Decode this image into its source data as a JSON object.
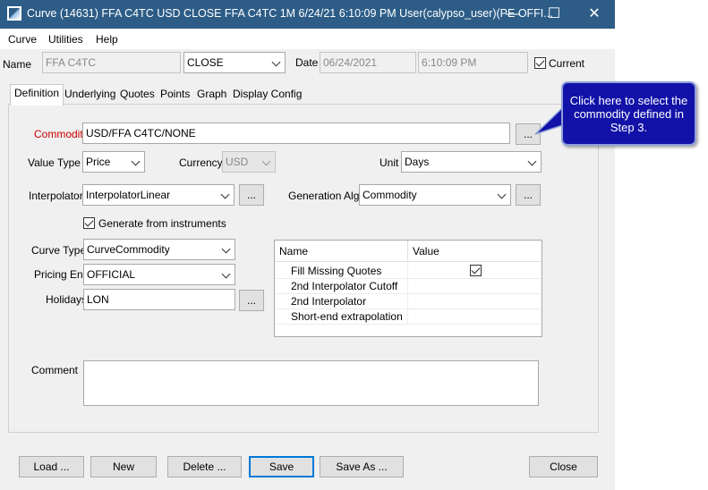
{
  "window": {
    "title": "Curve (14631) FFA C4TC USD CLOSE FFA C4TC 1M 6/24/21 6:10:09 PM User(calypso_user)(PE OFFI...",
    "minimize": "—",
    "maximize": "☐",
    "close": "✕"
  },
  "menu": {
    "items": [
      "Curve",
      "Utilities",
      "Help"
    ]
  },
  "header": {
    "name_label": "Name",
    "name_value": "FFA C4TC",
    "quote_set": "CLOSE",
    "date_label": "Date",
    "date_value": "06/24/2021",
    "time_value": "6:10:09 PM",
    "current_label": "Current",
    "current_checked": true
  },
  "tabs": [
    "Definition",
    "Underlying",
    "Quotes",
    "Points",
    "Graph",
    "Display Config"
  ],
  "definition": {
    "commodity_label": "Commodity",
    "commodity_value": "USD/FFA C4TC/NONE",
    "ellipsis": "...",
    "value_type_label": "Value Type",
    "value_type": "Price",
    "currency_label": "Currency",
    "currency": "USD",
    "unit_label": "Unit",
    "unit": "Days",
    "interpolator_label": "Interpolator",
    "interpolator": "InterpolatorLinear",
    "generation_label": "Generation Alg.",
    "generation": "Commodity",
    "generate_label": "Generate from instruments",
    "generate_checked": true,
    "curve_type_label": "Curve Type",
    "curve_type": "CurveCommodity",
    "pricing_env_label": "Pricing Env",
    "pricing_env": "OFFICIAL",
    "holidays_label": "Holidays",
    "holidays": "LON",
    "comment_label": "Comment",
    "comment": ""
  },
  "properties": {
    "columns": [
      "Name",
      "Value"
    ],
    "rows": [
      {
        "name": "Fill Missing Quotes",
        "checked": true
      },
      {
        "name": "2nd Interpolator Cutoff",
        "value": ""
      },
      {
        "name": "2nd Interpolator",
        "value": ""
      },
      {
        "name": "Short-end extrapolation",
        "value": ""
      }
    ]
  },
  "buttons": {
    "load": "Load ...",
    "new": "New",
    "delete": "Delete ...",
    "save": "Save",
    "save_as": "Save As ...",
    "close": "Close"
  },
  "callout": {
    "text": "Click here to select the commodity defined in Step 3."
  },
  "colors": {
    "titlebar": "#2d5d87",
    "callout_bg": "#1212a8",
    "commodity_label": "#cc0000",
    "default_button_border": "#0078d7"
  }
}
